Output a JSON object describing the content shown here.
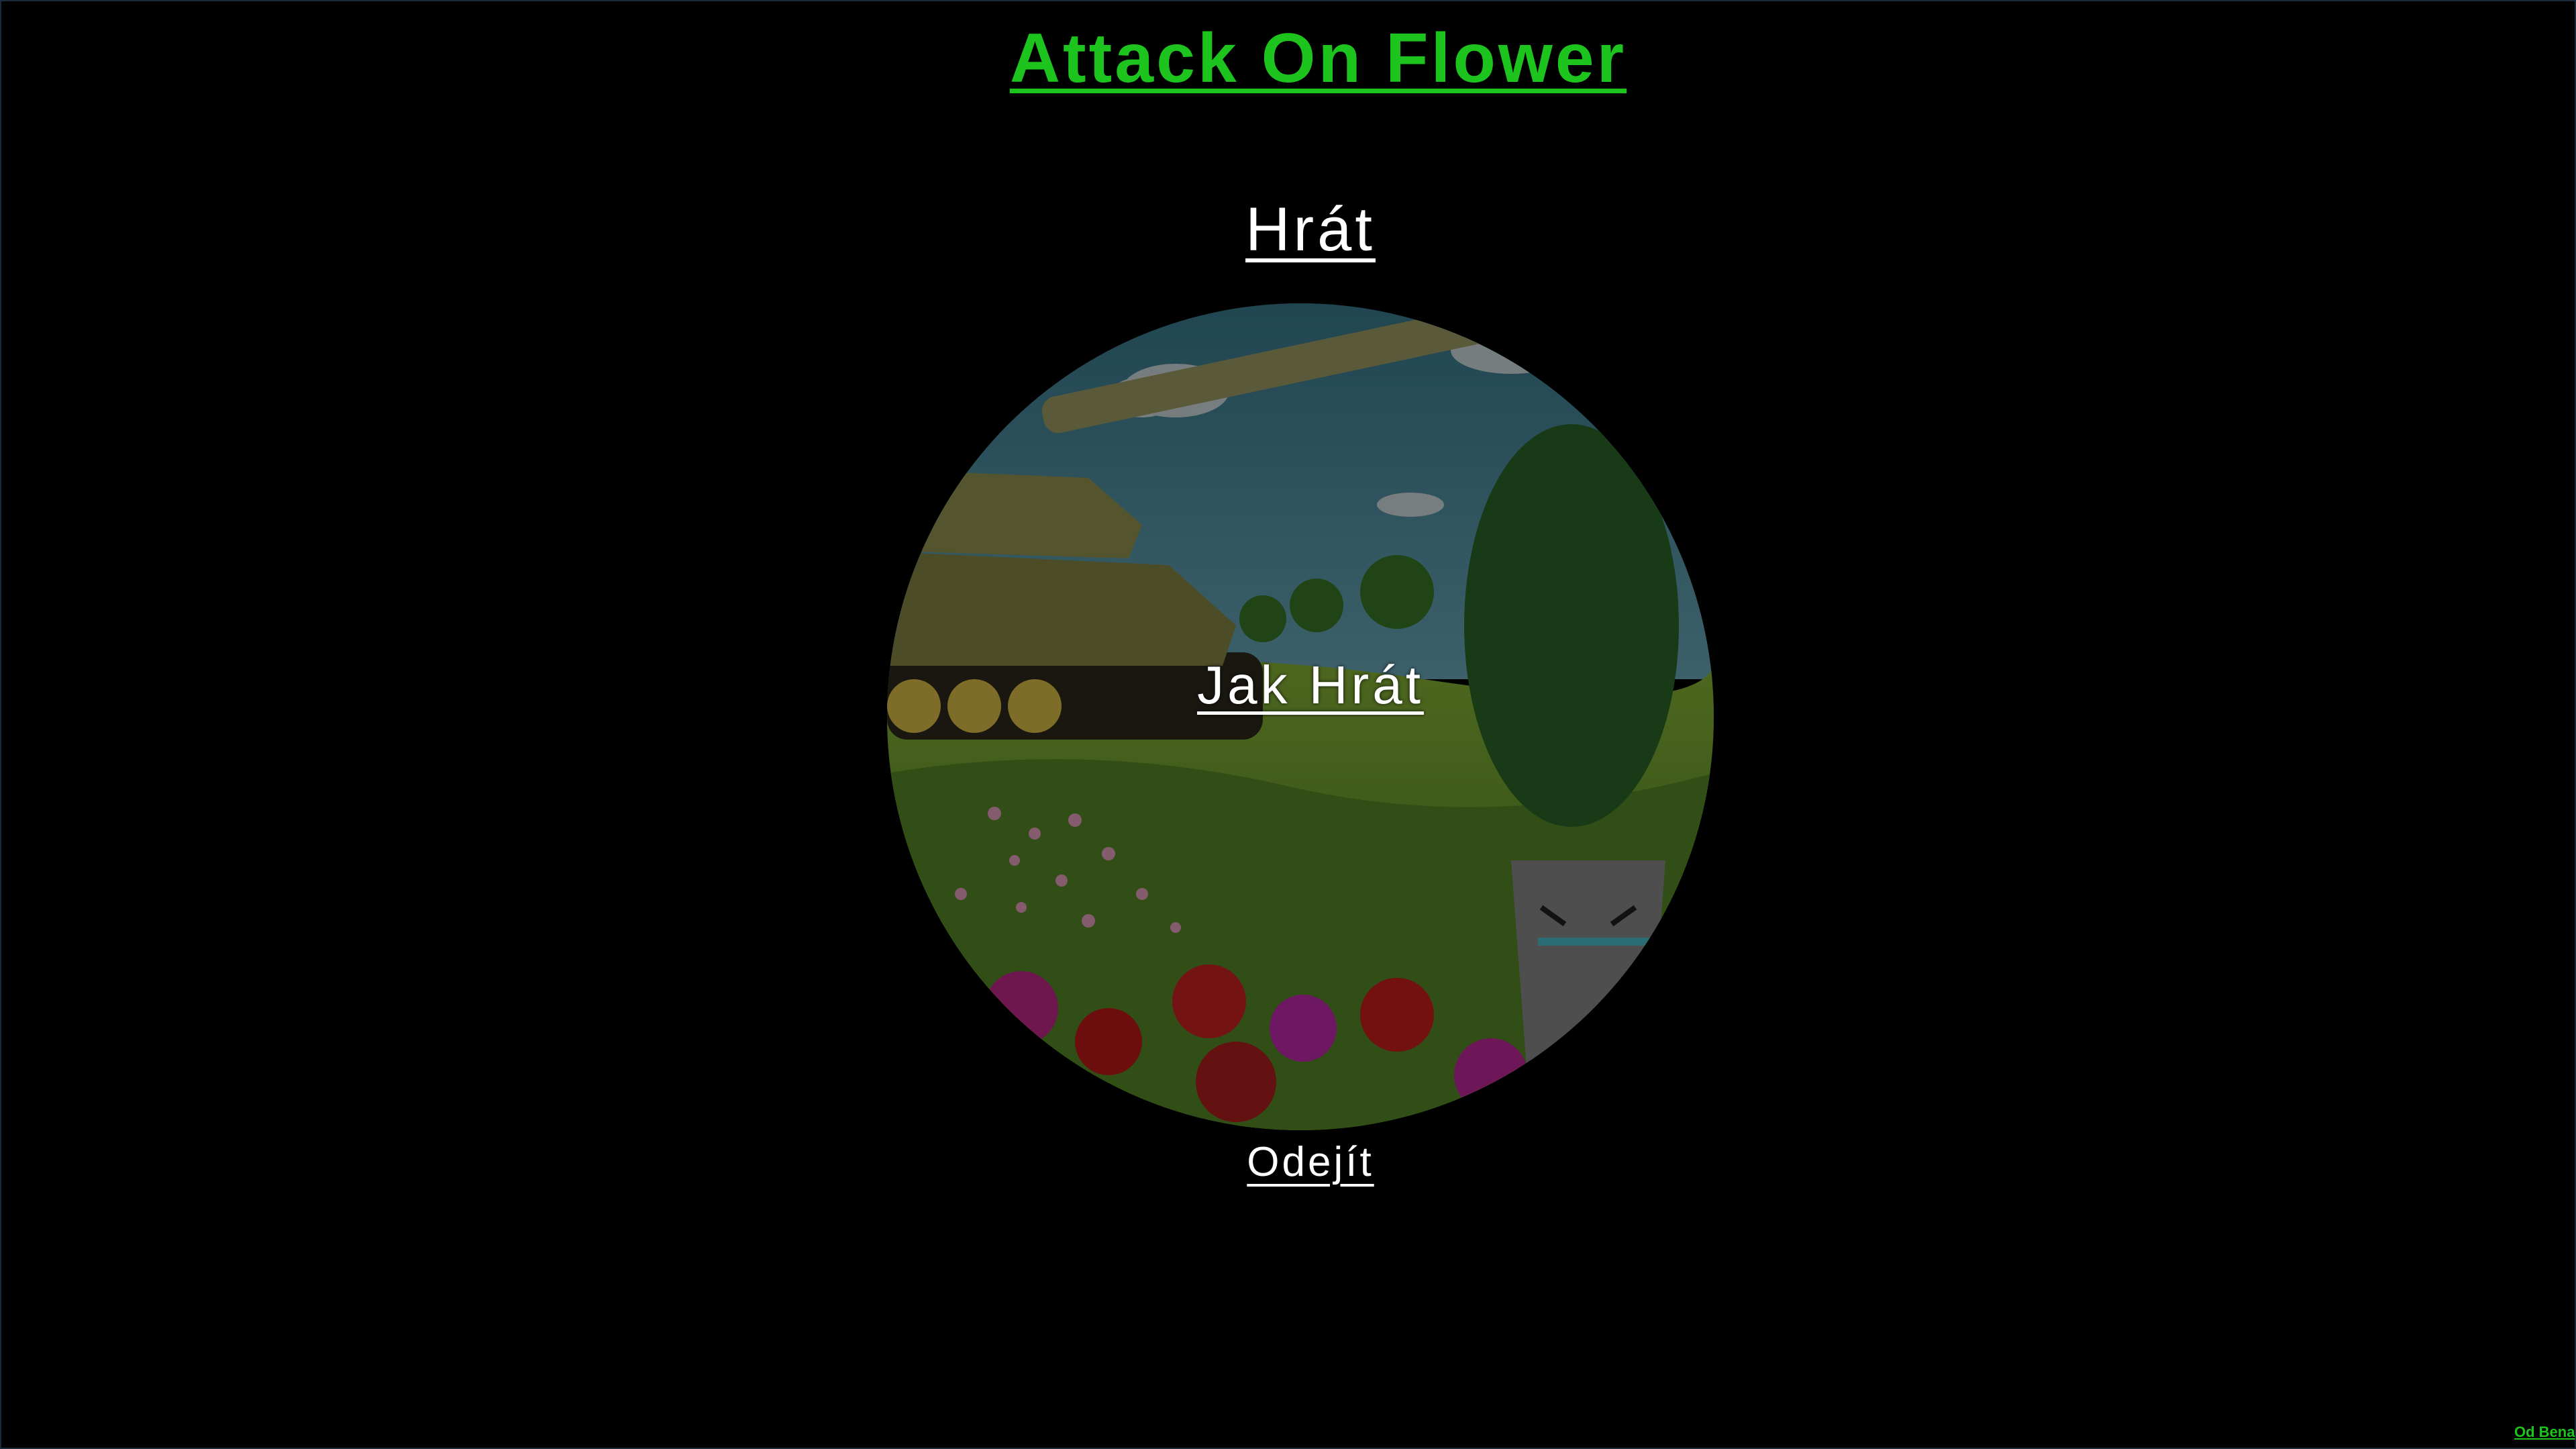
{
  "game": {
    "title": "Attack On Flower"
  },
  "menu": {
    "play_label": "Hrát",
    "how_to_play_label": "Jak Hrát",
    "exit_label": "Odejít"
  },
  "footer": {
    "credit": "Od Bena"
  },
  "colors": {
    "background": "#000000",
    "title": "#1dc41d",
    "menu_text": "#ffffff",
    "credit": "#1dc41d"
  },
  "art": {
    "description_icons": [
      "tank-icon",
      "flower-pot-character-icon",
      "flower-field-icon"
    ]
  }
}
